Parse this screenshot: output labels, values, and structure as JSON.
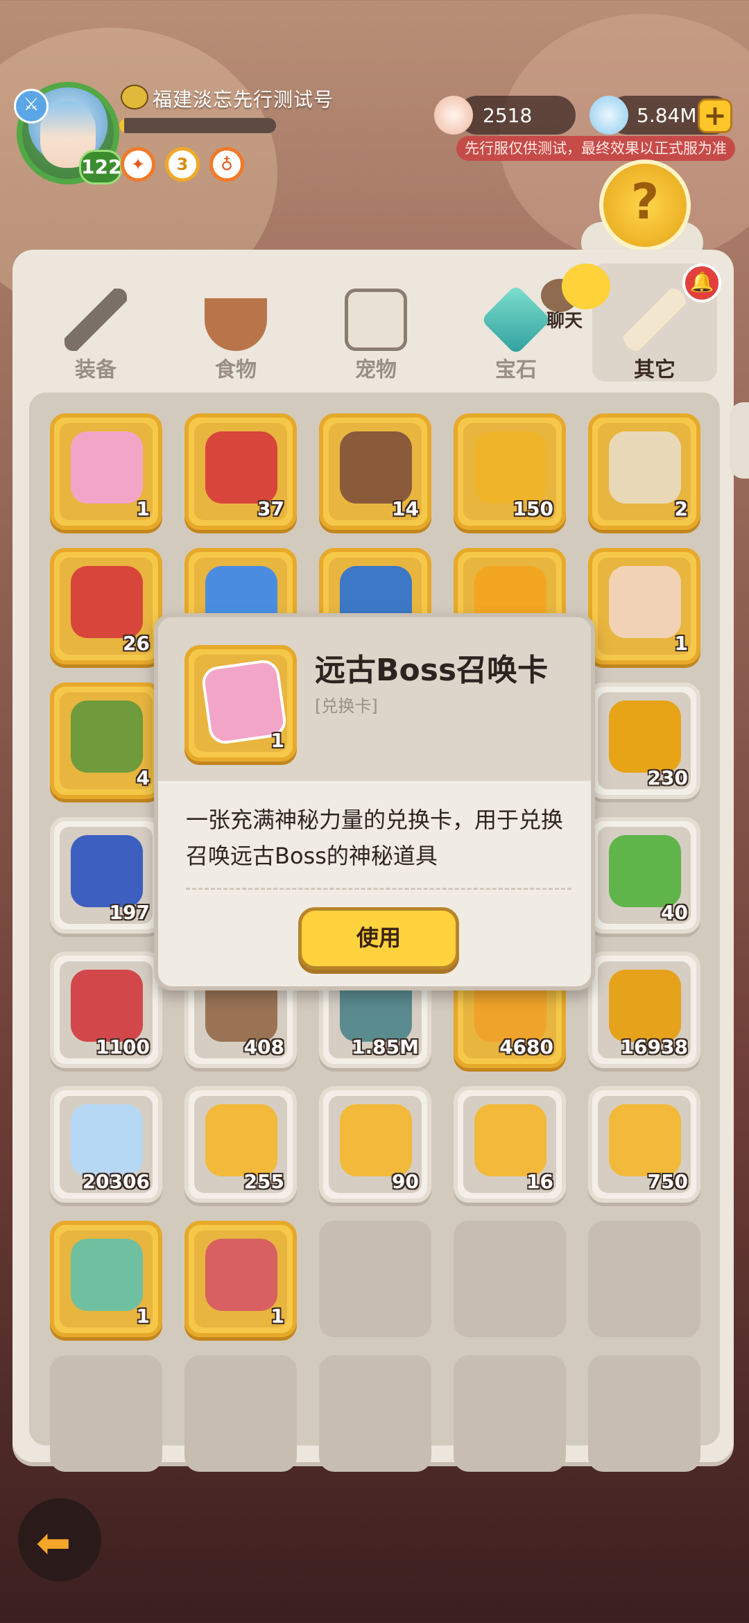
{
  "player": {
    "name": "福建淡忘先行测试号",
    "level": "122",
    "xp_fraction": 0.03
  },
  "currency": {
    "pearls": "2518",
    "crystals": "5.84M",
    "plus_icon": "plus-icon"
  },
  "notice": "先行服仅供测试，最终效果以正式服为准",
  "tabs": [
    {
      "label": "装备",
      "icon": "hammer-icon",
      "active": false
    },
    {
      "label": "食物",
      "icon": "food-bowl-icon",
      "active": false
    },
    {
      "label": "宠物",
      "icon": "skull-icon",
      "active": false
    },
    {
      "label": "宝石",
      "icon": "gem-icon",
      "active": false
    },
    {
      "label": "其它",
      "icon": "bone-icon",
      "active": true
    }
  ],
  "chat_label": "聊天",
  "items": [
    {
      "count": "1",
      "icon": "pink-card-icon",
      "tier": "gold",
      "color": "#f3a5c8"
    },
    {
      "count": "37",
      "icon": "red-chest-icon",
      "tier": "gold",
      "color": "#d8453a"
    },
    {
      "count": "14",
      "icon": "brown-chest-icon",
      "tier": "gold",
      "color": "#8a5a3a"
    },
    {
      "count": "150",
      "icon": "gold-coin-icon",
      "tier": "gold",
      "color": "#f0b42a"
    },
    {
      "count": "2",
      "icon": "skull-chest-icon",
      "tier": "gold",
      "color": "#e9d9b8"
    },
    {
      "count": "26",
      "icon": "red-chest-icon",
      "tier": "gold",
      "color": "#d8453a"
    },
    {
      "count": "",
      "icon": "winged-gem-icon",
      "tier": "gold",
      "color": "#4a8de0"
    },
    {
      "count": "",
      "icon": "blue-scroll-icon",
      "tier": "gold",
      "color": "#3c78c6"
    },
    {
      "count": "",
      "icon": "amber-crystal-icon",
      "tier": "gold",
      "color": "#f2a622"
    },
    {
      "count": "1",
      "icon": "caveman-portrait-icon",
      "tier": "gold",
      "color": "#f2d2b4"
    },
    {
      "count": "4",
      "icon": "stone-golem-icon",
      "tier": "gold",
      "color": "#6f9b3c"
    },
    {
      "count": "",
      "icon": "",
      "tier": "gold",
      "color": "#e8b53f"
    },
    {
      "count": "",
      "icon": "",
      "tier": "gold",
      "color": "#e8b53f"
    },
    {
      "count": "",
      "icon": "",
      "tier": "gold",
      "color": "#e8b53f"
    },
    {
      "count": "230",
      "icon": "sun-coin-icon",
      "tier": "silver",
      "color": "#e8a417"
    },
    {
      "count": "197",
      "icon": "blue-rune-stone-icon",
      "tier": "silver",
      "color": "#3d5fc0"
    },
    {
      "count": "",
      "icon": "",
      "tier": "silver",
      "color": "#d6cec3"
    },
    {
      "count": "",
      "icon": "",
      "tier": "silver",
      "color": "#d6cec3"
    },
    {
      "count": "",
      "icon": "",
      "tier": "silver",
      "color": "#d6cec3"
    },
    {
      "count": "40",
      "icon": "green-ticket-icon",
      "tier": "silver",
      "color": "#5fb44a"
    },
    {
      "count": "1100",
      "icon": "red-ticket-icon",
      "tier": "silver",
      "color": "#d2474a"
    },
    {
      "count": "408",
      "icon": "brown-tablet-icon",
      "tier": "silver",
      "color": "#9a7355"
    },
    {
      "count": "1.85M",
      "icon": "teal-rune-icon",
      "tier": "silver",
      "color": "#5a8b8f"
    },
    {
      "count": "4680",
      "icon": "orange-coin-icon",
      "tier": "gold",
      "color": "#f0a32a"
    },
    {
      "count": "16938",
      "icon": "gold-token-icon",
      "tier": "silver",
      "color": "#e7a21c"
    },
    {
      "count": "20306",
      "icon": "rainbow-crystal-icon",
      "tier": "silver",
      "color": "#b7d8f5"
    },
    {
      "count": "255",
      "icon": "stamp-icon",
      "tier": "silver",
      "color": "#f2b93a"
    },
    {
      "count": "90",
      "icon": "goggles-stamp-icon",
      "tier": "silver",
      "color": "#f2b93a"
    },
    {
      "count": "16",
      "icon": "chick-stamp-icon",
      "tier": "silver",
      "color": "#f2b93a"
    },
    {
      "count": "750",
      "icon": "face-stamp-icon",
      "tier": "silver",
      "color": "#f2b93a"
    },
    {
      "count": "1",
      "icon": "island-scene-icon",
      "tier": "gold",
      "color": "#6fc0a0"
    },
    {
      "count": "1",
      "icon": "whale-scene-icon",
      "tier": "gold",
      "color": "#d86060"
    },
    {
      "count": "",
      "icon": "",
      "tier": "empty",
      "color": ""
    },
    {
      "count": "",
      "icon": "",
      "tier": "empty",
      "color": ""
    },
    {
      "count": "",
      "icon": "",
      "tier": "empty",
      "color": ""
    },
    {
      "count": "",
      "icon": "",
      "tier": "empty",
      "color": ""
    },
    {
      "count": "",
      "icon": "",
      "tier": "empty",
      "color": ""
    },
    {
      "count": "",
      "icon": "",
      "tier": "empty",
      "color": ""
    },
    {
      "count": "",
      "icon": "",
      "tier": "empty",
      "color": ""
    },
    {
      "count": "",
      "icon": "",
      "tier": "empty",
      "color": ""
    }
  ],
  "popup": {
    "title": "远古Boss召唤卡",
    "subtitle": "[兑换卡]",
    "count": "1",
    "description": "一张充满神秘力量的兑换卡，用于兑换召唤远古Boss的神秘道具",
    "use_label": "使用",
    "icon": "pink-card-icon"
  },
  "back_icon": "back-arrow-icon"
}
